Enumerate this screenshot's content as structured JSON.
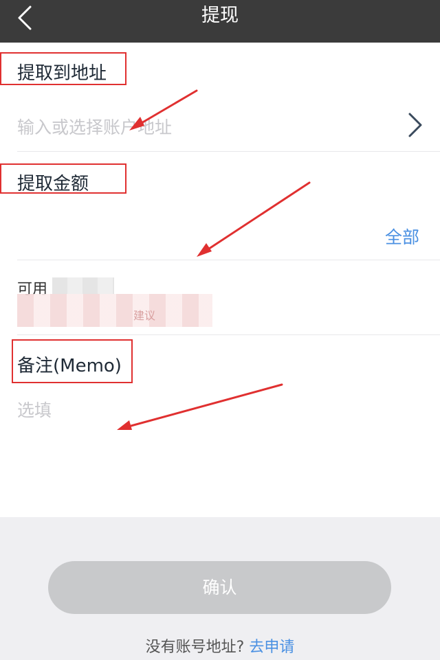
{
  "header": {
    "title": "提现",
    "back_icon": "chevron-left-icon"
  },
  "address_section": {
    "label": "提取到地址",
    "placeholder": "输入或选择账户地址",
    "chevron_icon": "chevron-right-icon"
  },
  "amount_section": {
    "label": "提取金额",
    "all_label": "全部",
    "available_label": "可用",
    "blurred_text": "建议"
  },
  "memo_section": {
    "label": "备注(Memo)",
    "placeholder": "选填"
  },
  "footer": {
    "confirm_label": "确认",
    "no_account_text": "没有账号地址?",
    "apply_link": "去申请"
  },
  "colors": {
    "nav_bg": "#3b3b3b",
    "link": "#4a90e2",
    "annotation": "#e03030",
    "button_disabled": "#c8c9cb"
  }
}
